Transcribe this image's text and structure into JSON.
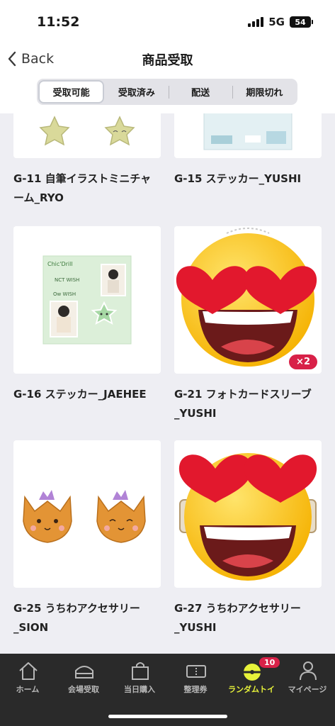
{
  "status": {
    "time": "11:52",
    "network": "5G",
    "battery": "54"
  },
  "nav": {
    "back_label": "Back",
    "title": "商品受取"
  },
  "segments": [
    {
      "label": "受取可能",
      "active": true
    },
    {
      "label": "受取済み",
      "active": false
    },
    {
      "label": "配送",
      "active": false
    },
    {
      "label": "期限切れ",
      "active": false
    }
  ],
  "items": [
    {
      "label": "G-11 自筆イラストミニチャーム_RYO"
    },
    {
      "label": "G-15 ステッカー_YUSHI"
    },
    {
      "label": "G-16 ステッカー_JAEHEE"
    },
    {
      "label": "G-21 フォトカードスリーブ_YUSHI",
      "badge": "×2"
    },
    {
      "label": "G-25 うちわアクセサリー_SION"
    },
    {
      "label": "G-27 うちわアクセサリー_YUSHI"
    }
  ],
  "sticker_texts": {
    "brand": "Chic'Drill",
    "nct_wish": "NCT WISH",
    "ow_wish": "Ow WISH"
  },
  "tabs": [
    {
      "label": "ホーム",
      "icon": "home-icon"
    },
    {
      "label": "会場受取",
      "icon": "venue-icon"
    },
    {
      "label": "当日購入",
      "icon": "shopping-bag-icon"
    },
    {
      "label": "整理券",
      "icon": "ticket-icon"
    },
    {
      "label": "ランダムトイ",
      "icon": "random-toy-icon",
      "badge": "10",
      "active": true
    },
    {
      "label": "マイページ",
      "icon": "person-icon"
    }
  ],
  "colors": {
    "accent_active_tab": "#e7f23a",
    "badge": "#d82148",
    "tab_bar": "#2a2a2a",
    "background": "#eeeef3"
  }
}
